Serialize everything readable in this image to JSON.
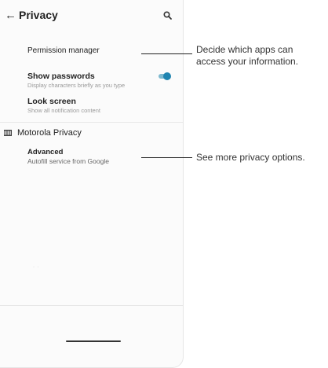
{
  "appbar": {
    "title": "Privacy"
  },
  "items": {
    "permission_manager": {
      "label": "Permission manager"
    },
    "show_passwords": {
      "label": "Show passwords",
      "summary": "Display characters briefly as you type",
      "toggle_on": true
    },
    "lock_screen": {
      "label": "Look screen",
      "summary": "Show all notification content"
    },
    "motorola_privacy": {
      "label": "Motorola Privacy"
    },
    "advanced": {
      "label": "Advanced",
      "summary": "Autofill service from Google"
    }
  },
  "callouts": {
    "permission_line1": "Decide which apps can",
    "permission_line2": "access your information.",
    "advanced": "See more privacy options."
  },
  "colors": {
    "toggle_thumb": "#1f84b0",
    "toggle_track": "#7db9cf"
  }
}
